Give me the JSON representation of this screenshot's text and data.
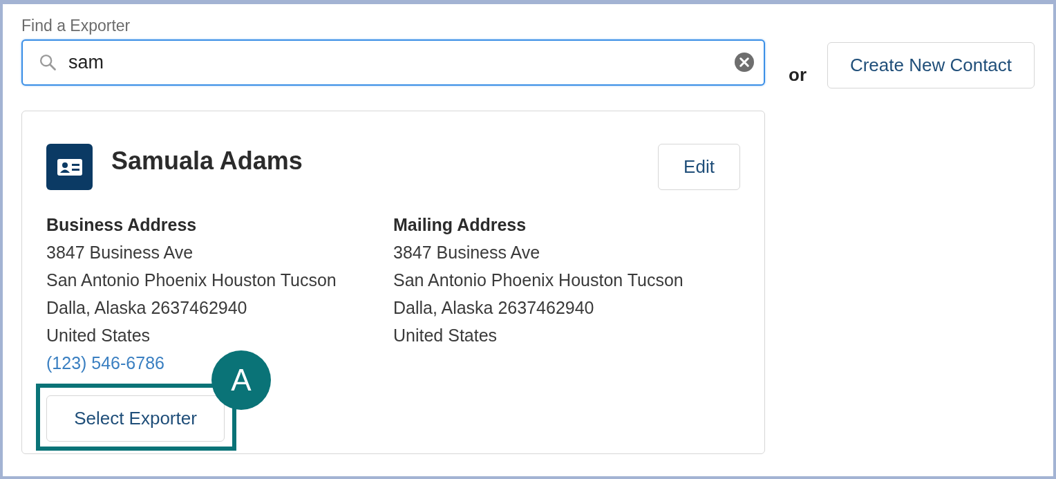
{
  "search": {
    "label": "Find a Exporter",
    "value": "sam"
  },
  "separator": "or",
  "create_button": "Create New Contact",
  "contact": {
    "name": "Samuala Adams",
    "edit_button": "Edit",
    "addresses": [
      {
        "title": "Business Address",
        "lines": [
          "3847 Business Ave",
          "San Antonio Phoenix Houston Tucson",
          "Dalla, Alaska 2637462940",
          "United States"
        ],
        "phone": "(123) 546-6786"
      },
      {
        "title": "Mailing Address",
        "lines": [
          "3847 Business Ave",
          "San Antonio Phoenix Houston Tucson",
          "Dalla, Alaska 2637462940",
          "United States"
        ]
      }
    ],
    "select_button": "Select Exporter"
  },
  "callout": {
    "label": "A"
  }
}
